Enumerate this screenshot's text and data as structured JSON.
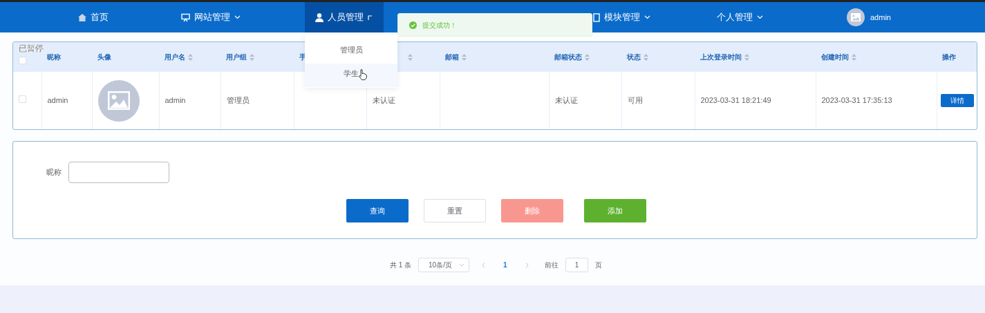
{
  "nav": {
    "items": [
      {
        "label": "首页",
        "kind": "home",
        "dropdown": false,
        "selected": false
      },
      {
        "label": "网站管理",
        "kind": "screen",
        "dropdown": true,
        "selected": false
      },
      {
        "label": "人员管理",
        "kind": "person",
        "dropdown": true,
        "selected": true
      },
      {
        "label": "模块管理",
        "kind": "module",
        "dropdown": true,
        "selected": false
      },
      {
        "label": "个人管理",
        "kind": "text",
        "dropdown": true,
        "selected": false
      }
    ],
    "user": {
      "name": "admin"
    }
  },
  "dropdown": {
    "items": [
      {
        "label": "管理员",
        "hovered": false
      },
      {
        "label": "学生",
        "hovered": true
      }
    ]
  },
  "toast": {
    "text": "提交成功！"
  },
  "overlay_label": "已暂停",
  "table": {
    "header_checked": false,
    "columns": [
      {
        "label": "昵称",
        "sortable": false
      },
      {
        "label": "头像",
        "sortable": false
      },
      {
        "label": "用户名",
        "sortable": true
      },
      {
        "label": "用户组",
        "sortable": true
      },
      {
        "label": "手"
      },
      {
        "sortable": true
      },
      {
        "label": "邮箱",
        "sortable": true
      },
      {
        "label": "邮箱状态",
        "sortable": true
      },
      {
        "label": "状态",
        "sortable": true
      },
      {
        "label": "上次登录时间",
        "sortable": true
      },
      {
        "label": "创建时间",
        "sortable": true
      },
      {
        "label": "操作",
        "sortable": false
      }
    ],
    "rows": [
      {
        "checked": false,
        "cells": [
          "admin",
          null,
          "admin",
          "管理员",
          "",
          "未认证",
          "",
          "未认证",
          "可用",
          "2023-03-31 18:21:49",
          "2023-03-31 17:35:13"
        ],
        "action": "详情"
      }
    ]
  },
  "search": {
    "label": "昵称"
  },
  "buttons": [
    {
      "label": "查询",
      "kind": "primary"
    },
    {
      "label": "重置",
      "kind": "plain"
    },
    {
      "label": "删除",
      "kind": "danger"
    },
    {
      "label": "添加",
      "kind": "success"
    }
  ],
  "pagination": {
    "total": "共 1 条",
    "page_size": "10条/页",
    "pages": [
      {
        "label": "1",
        "selected": true
      }
    ],
    "goto_label": "前往",
    "goto_value": "1",
    "suffix": "页"
  }
}
